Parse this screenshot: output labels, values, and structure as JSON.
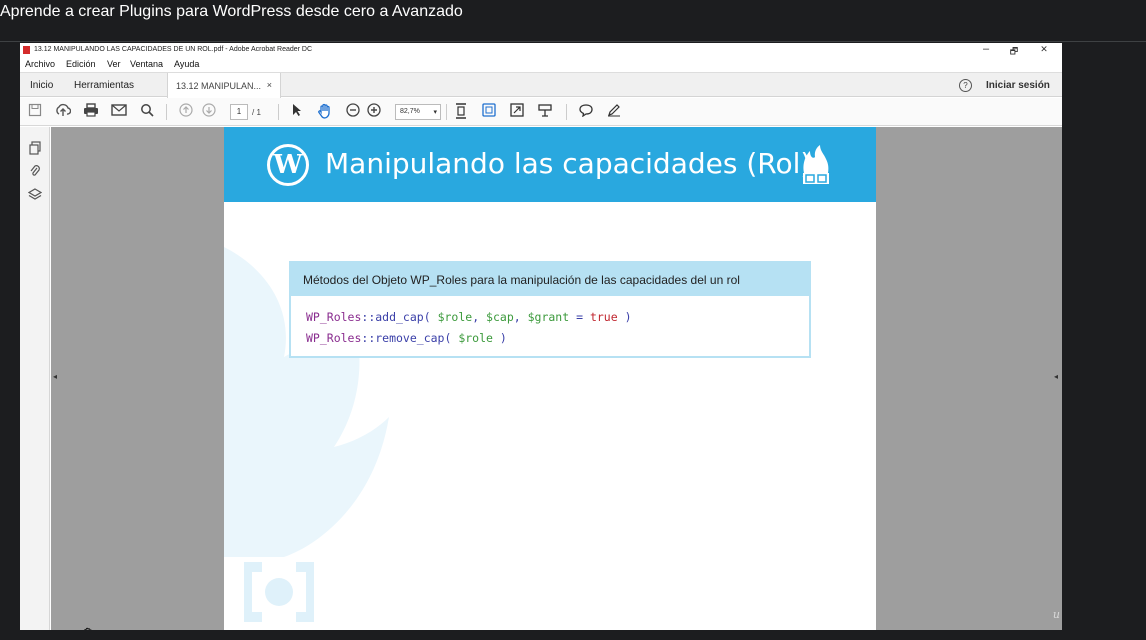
{
  "course": {
    "title": "Aprende a crear Plugins para WordPress desde cero a Avanzado"
  },
  "window": {
    "title": "13.12 MANIPULANDO LAS CAPACIDADES DE UN ROL.pdf - Adobe Acrobat Reader DC",
    "minimize": "–",
    "restore": "🗗",
    "close": "✕"
  },
  "menu": {
    "items": [
      "Archivo",
      "Edición",
      "Ver",
      "Ventana",
      "Ayuda"
    ]
  },
  "tabs": {
    "home": "Inicio",
    "tools": "Herramientas",
    "document": "13.12 MANIPULAN...",
    "close": "×",
    "help": "?",
    "signin": "Iniciar sesión"
  },
  "toolbar": {
    "page_current": "1",
    "page_total": "/ 1",
    "zoom": "82,7%"
  },
  "slide": {
    "title": "Manipulando las capacidades (Rol)",
    "wp_logo": "W",
    "card_heading": "Métodos del Objeto WP_Roles para la manipulación de las capacidades del un rol",
    "code_line1": {
      "cls": "WP_Roles",
      "method": "::add_cap( ",
      "v1": "$role",
      "sep1": ", ",
      "v2": "$cap",
      "sep2": ", ",
      "v3": "$grant",
      "eq": " = ",
      "kw": "true",
      "end": " )"
    },
    "code_line2": {
      "cls": "WP_Roles",
      "method": "::remove_cap( ",
      "v1": "$role",
      "end": " )"
    }
  },
  "icons": {
    "save": "save-icon",
    "upload": "upload-icon",
    "print": "print-icon",
    "email": "email-icon",
    "search": "search-icon",
    "prev": "page-up-icon",
    "next": "page-down-icon",
    "select": "select-cursor-icon",
    "hand": "hand-icon",
    "zoom_out": "zoom-out-icon",
    "zoom_in": "zoom-in-icon",
    "fit": "fit-page-icon",
    "comment": "comment-icon",
    "pen": "pen-icon",
    "copy": "pages-icon",
    "attach": "attachment-icon",
    "layers": "layers-icon"
  },
  "colors": {
    "banner": "#29a8df",
    "card": "#b6e1f3",
    "class": "#8a2d8f",
    "variable": "#3c9a3c",
    "keyword": "#c0262f"
  }
}
